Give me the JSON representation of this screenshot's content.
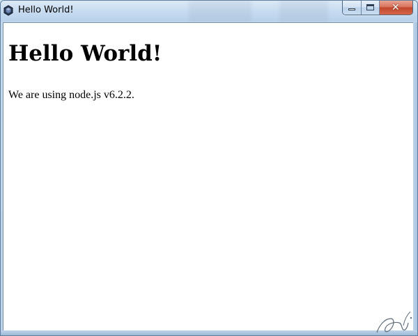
{
  "window": {
    "title": "Hello World!",
    "app_icon": "app-icon",
    "buttons": {
      "minimize_icon": "minimize-icon",
      "maximize_icon": "maximize-icon",
      "close_icon": "close-icon",
      "close_glyph": "✕"
    }
  },
  "content": {
    "heading": "Hello World!",
    "body": "We are using node.js v6.2.2."
  },
  "colors": {
    "frame": "#bcd3ea",
    "close": "#c2472c",
    "content_bg": "#ffffff",
    "text": "#000000"
  }
}
